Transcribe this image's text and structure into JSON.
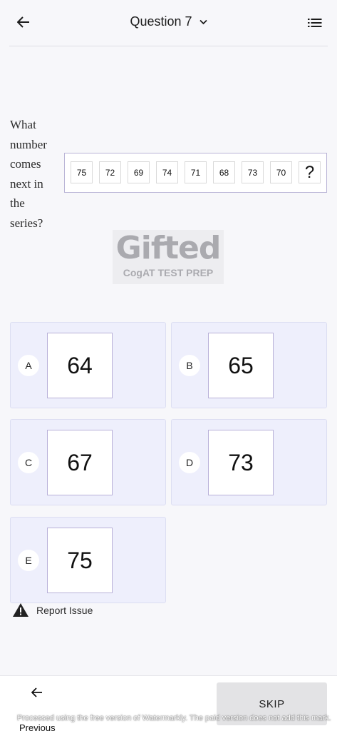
{
  "header": {
    "title": "Question 7",
    "back_icon": "arrow-left-icon",
    "dropdown_icon": "chevron-down-icon",
    "menu_icon": "list-icon"
  },
  "question": {
    "text": "What number comes next in the series?",
    "series": [
      "75",
      "72",
      "69",
      "74",
      "71",
      "68",
      "73",
      "70",
      "?"
    ]
  },
  "logo": {
    "main": "Gifted",
    "sub": "CogAT TEST PREP"
  },
  "options": [
    {
      "letter": "A",
      "value": "64"
    },
    {
      "letter": "B",
      "value": "65"
    },
    {
      "letter": "C",
      "value": "67"
    },
    {
      "letter": "D",
      "value": "73"
    },
    {
      "letter": "E",
      "value": "75"
    }
  ],
  "report": {
    "label": "Report Issue",
    "icon": "warning-icon"
  },
  "footer": {
    "previous_label": "Previous",
    "skip_label": "SKIP",
    "watermark": "Processed using the free version of Watermarkly. The paid version does not add this mark."
  },
  "colors": {
    "option_bg": "#eeeffc",
    "option_border": "#b8b0d8",
    "skip_bg": "#e3e3e5"
  }
}
